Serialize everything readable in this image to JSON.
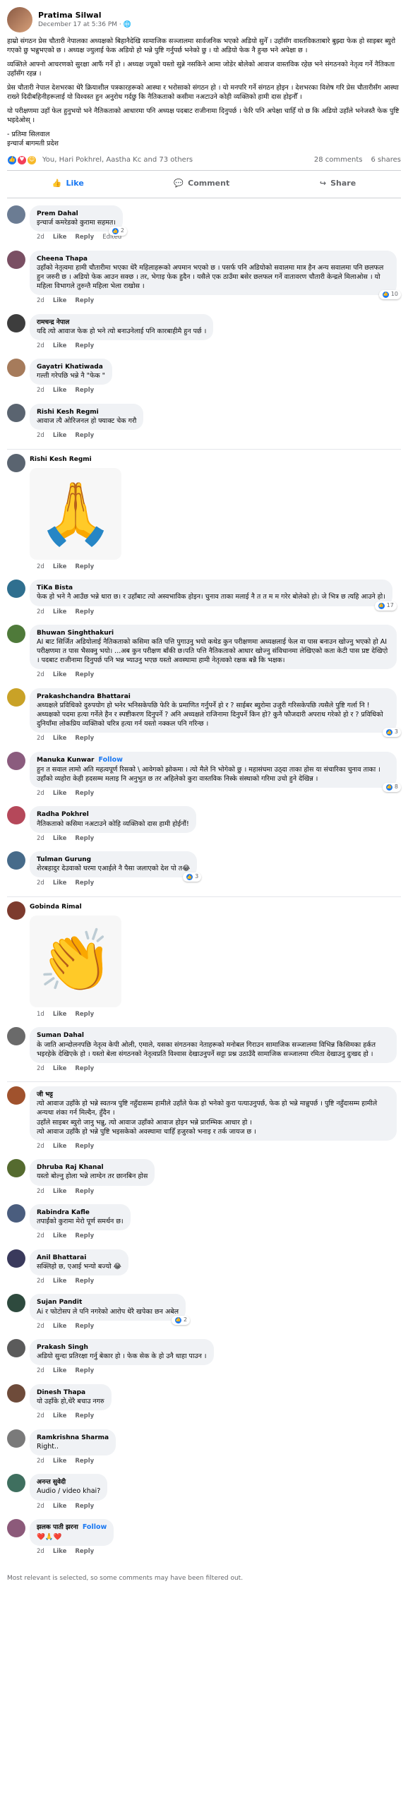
{
  "post": {
    "author": "Pratima Silwal",
    "meta": "December 17 at 5:36 PM · 🌐",
    "paragraphs": [
      "हाम्रो संगठन प्रेस चौतारी नेपालका अध्यक्षको बिहानैदेखि सामाजिक सञ्जालमा सार्वजनिक भएको अडियो सुनेँ । उहाँसँग वास्तविकताबारे बुझ्दा फेक हो साइबर ब्युरो गएको छु भन्नुभएको छ । अध्यक्ष ज्युलाई फेक अडियो हो भन्ने पुष्टि गर्नुपर्छ भनेको छु । यो अडियो फेक नै हुन्छ भने अपेक्षा छ ।",
      "व्यक्तिले आफ्नो आचरणको सुरक्षा आफैं गर्ने हो । अध्यक्ष ज्यूको यस्तो सुन्ने नसकिने आमा जोडेर बोलेको आवाज वास्तविक रहेछ भने संगठनको नेतृत्व गर्ने नैतिकता उहाँसँग रहन्न ।",
      "प्रेस चौतारी नेपाल देशभरका धेरै क्रियाशील पत्रकारहरूको आस्था र भरोसाको संगठन हो । यो मनपरि गर्ने संगठन होइन । देशभरका विशेष गरि प्रेस चौतारीसँग आस्था राख्ने दिदीबहिनीहरूलाई यो विश्वस्त हुन अनुरोध गर्दछु कि नैतिकताको कसीमा नअटाउने कोही व्यक्तिको हामी दास होइनौँ ।",
      "यो परीक्षणमा उहाँ फेल हुनुभयो भने नैतिकताको आधारमा पनि अध्यक्ष पदबाट राजीनामा दिनुपर्छ । फेरि पनि अपेक्षा चाहिँ यो छ कि अडियो उहाँले भनेजस्तै फेक पुष्टि भइदेओस् ।",
      "- प्रतिमा सिलवाल\nइन्चार्ज बागमती प्रदेश"
    ],
    "reactions_text": "You, Hari Pokhrel, Aastha Kc and 73 others",
    "comments_count": "28 comments",
    "shares_count": "6 shares",
    "actions": {
      "like": "Like",
      "comment": "Comment",
      "share": "Share"
    }
  },
  "comments": [
    {
      "name": "Prem Dahal",
      "text": "इन्चार्ज कमरेडको कुरामा सहमत।",
      "time": "2d",
      "edited": "Edited",
      "react": "2",
      "avatar": "#6b7c93"
    },
    {
      "name": "Cheena Thapa",
      "text": "उहाँको नेतृत्वमा हामी चौतारीमा भएका धेरै महिलाहरूको अपमान भएको छ । पसर्फ पनि अडियोको सवालमा मात्र हैन अन्य सवालमा पनि छलफल हुन जरुरी छ । अडियो फेक आउन सक्छ । तर, भेगाइ फेक हुदैन । यसैले एक ठाउँमा बसेर छलफल गर्ने वातावरण चौतारी केन्द्रले मिलाओस । यो महिला विभागले तुरुन्तै महिला भेला राखोस ।",
      "time": "2d",
      "react": "10",
      "avatar": "#7a4f63"
    },
    {
      "name": "रामचन्द्र नेपाल",
      "text": "यदि त्यो आवाज फेक हो भने त्यो बनाउनेलाई पनि कारबाहीमै हुन पर्छ ।",
      "time": "2d",
      "react": "",
      "avatar": "#3d3d3d"
    },
    {
      "name": "Gayatri Khatiwada",
      "text": "गल्ती गरेपछि भन्ने नै \"फेक \"",
      "time": "2d",
      "react": "",
      "avatar": "#a67b5b"
    },
    {
      "name": "Rishi Kesh Regmi",
      "text": "आवाज त्यै ओरिजनल हो फ्याक्ट चेक गरौ",
      "time": "2d",
      "react": "",
      "avatar": "#5a6470"
    },
    {
      "name": "Rishi Kesh Regmi",
      "text": "",
      "sticker": "praying-hands",
      "time": "2d",
      "react": "",
      "avatar": "#5a6470"
    },
    {
      "name": "TiKa Bista",
      "text": "फेक हो भने नै आउँछ भन्ने धारा छ। र उहाँबाट त्यो अस्वभाविक होइन। चुनाव ताका मलाई नै त त म म गरेर बोलेको हो। जे भित्र छ त्यहि आउने हो।",
      "time": "2d",
      "react": "17",
      "avatar": "#2f6f8f"
    },
    {
      "name": "Bhuwan Singhthakuri",
      "text": "AI बाट सिर्जित अडियोलाई नैतिकताको कसिमा कति पत्ति पुगाउनु भयो कथेड कुन परीक्षणमा अध्यक्षलाई फेल वा पास बनाउन खोज्नु भएको हो AI परीक्षणमा त पास भैसक्नु भयो। ...अब कुन परीक्षण बाँकी छ।पति पत्ति नैतिकताको आधार खोज्नु संविधानमा लेखिएको कता केटी पास प्रष्ट देखिएो । पदबाट राजीनामा दिनुपर्छ पनि भन्न भ्याउनु भएछ यस्तो अवस्थामा हामी नेतृत्वको रक्षक बन्नै कि भक्षक।",
      "time": "2d",
      "react": "",
      "avatar": "#4f7a3a"
    },
    {
      "name": "Prakashchandra Bhattarai",
      "text": "अध्यक्षले प्रविधिको दुरुपयोग हो भनेर भनिसकेपछि फेरि के प्रमाणित गर्नुपर्ने हो र ? साईबर ब्युरोमा उजुरी गरिसकेपछि त्यसैले पुष्टि गर्ला नि ! अध्यक्षको पदमा हत्या गर्नेले हैन र स्पष्टीकरण दिनुपर्ने ? अनि अध्यक्षले राजिनामा दिनुपर्ने किन हो? कुनै फौजदारी अपराध गरेको हो र ? प्रविधिको दुनियाँमा लोकप्रिय व्यक्तिको चरित्र हत्या गर्न यस्तो नक्कल पनि गरिन्छ ।",
      "time": "2d",
      "react": "3",
      "avatar": "#c9a227"
    },
    {
      "name": "Manuka Kunwar",
      "follow": "Follow",
      "text": "हुन त सवाल लामो अति महत्वपूर्ण रिसको \\ आवेगको झोकमा । त्यो मैले नि भोगेको छु । महासंघमा उठ्दा ताका होस या संचारिका चुनाव ताका । उहाँको व्यहोरा केही हदसम्म मलाइ नि अनुभुत छ तर अहिलेको कुरा वास्तविक निस्के संस्थाको गरिमा उचो हुने देखिन्न ।",
      "time": "2d",
      "react": "8",
      "avatar": "#8b5c7e"
    },
    {
      "name": "Radha Pokhrel",
      "text": "नैतिकताको कसिमा नअटाउने कोहि व्यक्तिको दास हामी होईनौं!",
      "time": "2d",
      "react": "",
      "avatar": "#b5485a"
    },
    {
      "name": "Tulman Gurung",
      "text": "शेरबहादुर देउवाको घरमा एआईले नै पैसा जलाएको देश पो त😂",
      "time": "2d",
      "react": "3",
      "avatar": "#476b8a"
    },
    {
      "name": "Gobinda Rimal",
      "text": "",
      "sticker": "clapping-hands",
      "time": "1d",
      "react": "",
      "avatar": "#7d3b2e"
    },
    {
      "name": "Suman Dahal",
      "text": "के जाति आन्दोलनपछि नेतृत्व केपी ओली, एमाले, यसका संगठनका नेताहरूको मनोबल गिराउन सामाजिक सञ्जालमा विभिन्न किसिमका हर्कत भइरहेके देखिएके हो । यस्तो बेला संगठनको नेतृत्वप्रति विश्वास देखाउनुपर्ने सट्टा प्रश्न उठाउँदै सामाजिक सञ्जालमा रमिता देखाउनु दुःखद हो ।",
      "time": "2d",
      "react": "",
      "avatar": "#6a6a6a"
    },
    {
      "name": "जी भट्ट",
      "text": "त्यो आवाज उहाँके हो भन्ने स्वतन्त्र पुष्टि नहुँदासम्म हामीले उहाँले फेक हो भनेको कुरा पत्याउनुपर्छ, फेक हो भन्ने मान्नुपर्छ । पुष्टि नहुँदासम्म हामीले अन्यथा शंका गर्न मिल्दैन, हुँदैन ।\nउहाँले साइबर ब्युरो जानु भन्नु, त्यो आवाज उहाँको आवाज होइन भन्ने प्रारम्भिक आधार हो ।\nत्यो आवाज उहाँकै हो भन्ने पुष्टि भइसकेको अवस्थामा चाहिँ हजुरको भनाइ र तर्क जायज छ ।",
      "time": "2d",
      "react": "",
      "avatar": "#a0522d"
    },
    {
      "name": "Dhruba Raj Khanal",
      "text": "यस्तो बोल्नु होला भन्ने लाग्देन तर छानबिन होस",
      "time": "2d",
      "react": "",
      "avatar": "#556b2f"
    },
    {
      "name": "Rabindra Kafle",
      "text": "तपाईंको कुरामा मेरो पूर्ण समर्थन छ।",
      "time": "2d",
      "react": "",
      "avatar": "#4a5d7e"
    },
    {
      "name": "Anil Bhattarai",
      "text": "सक्लिहो छ, एआई भन्यो बज्यो 😂",
      "time": "2d",
      "react": "",
      "avatar": "#3a3a5c"
    },
    {
      "name": "Sujan Pandit",
      "text": "Ai र फोटोसप ले पनि नगरेको आरोप धेरै खपेका छन अबेल",
      "time": "2d",
      "react": "2",
      "avatar": "#2e4a3e"
    },
    {
      "name": "Prakash Singh",
      "text": "अडियो सुन्दा प्रतिरक्षा गर्नु बेकार हो । फेक सेक के हो उनै धाहा पाउन ।",
      "time": "2d",
      "react": "",
      "avatar": "#5b5b5b"
    },
    {
      "name": "Dinesh Thapa",
      "text": "यो उहाँके हो,धेरै बचाउ नगरु",
      "time": "2d",
      "react": "",
      "avatar": "#6e4b3a"
    },
    {
      "name": "Ramkrishna Sharma",
      "text": "Right..",
      "time": "2d",
      "react": "",
      "avatar": "#7a7a7a"
    },
    {
      "name": "अनन्त सुवेदी",
      "text": "Audio / video khai?",
      "time": "2d",
      "react": "",
      "avatar": "#3f6f5f"
    },
    {
      "name": "झलक पाती झरना",
      "follow": "Follow",
      "text": "❤️🙏❤️",
      "time": "2d",
      "react": "",
      "avatar": "#8c5a7a"
    }
  ],
  "comment_actions": {
    "like": "Like",
    "reply": "Reply"
  },
  "footer_note": "Most relevant is selected, so some comments may have been filtered out."
}
